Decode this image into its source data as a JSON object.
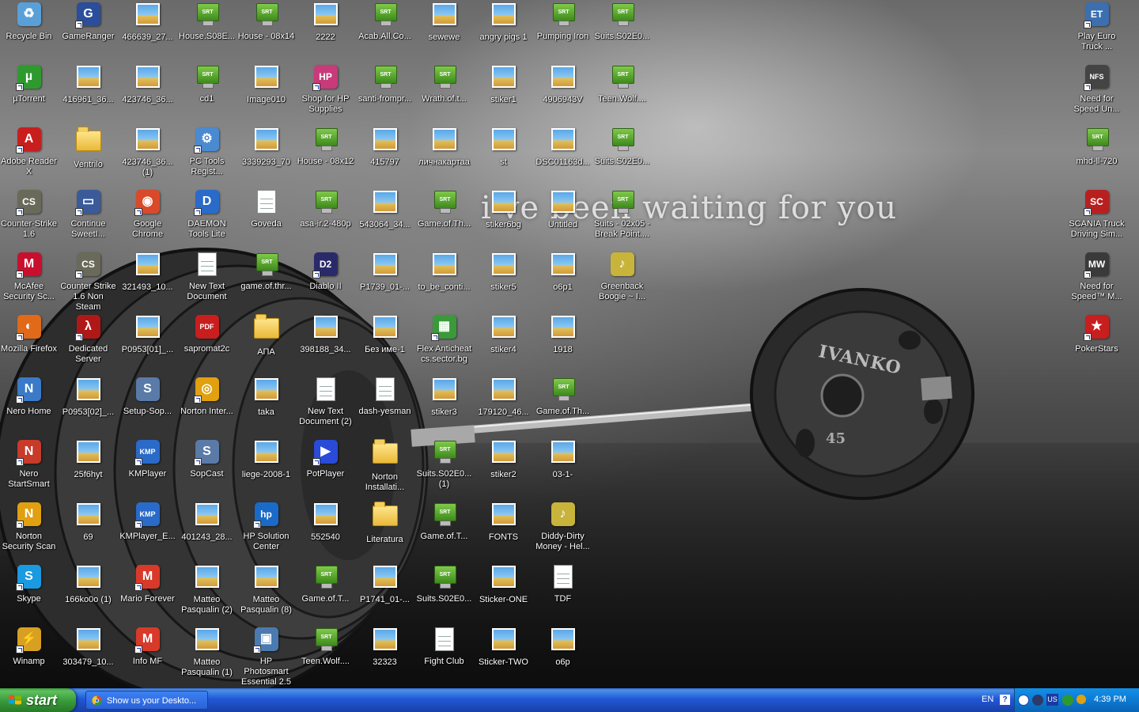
{
  "wallpaper": {
    "tagline": "i've been waiting for you",
    "plate_brand": "IVANKO",
    "plate_weight": "45"
  },
  "icons": [
    {
      "label": "Recycle Bin",
      "col": 0,
      "row": 0,
      "kind": "app",
      "color": "#5aa0d8",
      "glyph": "♻",
      "shortcut": false
    },
    {
      "label": "GameRanger",
      "col": 1,
      "row": 0,
      "kind": "app",
      "color": "#2a4d9c",
      "glyph": "G",
      "shortcut": true
    },
    {
      "label": "466639_27...",
      "col": 2,
      "row": 0,
      "kind": "image"
    },
    {
      "label": "House.S08E...",
      "col": 3,
      "row": 0,
      "kind": "srt"
    },
    {
      "label": "House - 08x14",
      "col": 4,
      "row": 0,
      "kind": "srt"
    },
    {
      "label": "2222",
      "col": 5,
      "row": 0,
      "kind": "image"
    },
    {
      "label": "Acab.All.Co...",
      "col": 6,
      "row": 0,
      "kind": "srt"
    },
    {
      "label": "sewewe",
      "col": 7,
      "row": 0,
      "kind": "image"
    },
    {
      "label": "angry pigs 1",
      "col": 8,
      "row": 0,
      "kind": "image"
    },
    {
      "label": "Pumping Iron",
      "col": 9,
      "row": 0,
      "kind": "srt"
    },
    {
      "label": "Suits.S02E0...",
      "col": 10,
      "row": 0,
      "kind": "srt"
    },
    {
      "label": "Play Euro Truck ...",
      "col": 18,
      "row": 0,
      "kind": "app",
      "color": "#3b6fb0",
      "glyph": "ET",
      "shortcut": true
    },
    {
      "label": "µTorrent",
      "col": 0,
      "row": 1,
      "kind": "app",
      "color": "#2e9a2e",
      "glyph": "µ",
      "shortcut": true
    },
    {
      "label": "416961_36...",
      "col": 1,
      "row": 1,
      "kind": "image"
    },
    {
      "label": "423746_36...",
      "col": 2,
      "row": 1,
      "kind": "image"
    },
    {
      "label": "cd1",
      "col": 3,
      "row": 1,
      "kind": "srt"
    },
    {
      "label": "Image010",
      "col": 4,
      "row": 1,
      "kind": "image"
    },
    {
      "label": "Shop for HP Supplies",
      "col": 5,
      "row": 1,
      "kind": "app",
      "color": "#c83a7a",
      "glyph": "HP",
      "shortcut": true
    },
    {
      "label": "santi-frompr...",
      "col": 6,
      "row": 1,
      "kind": "srt"
    },
    {
      "label": "Wrath.of.t...",
      "col": 7,
      "row": 1,
      "kind": "srt"
    },
    {
      "label": "stiker1",
      "col": 8,
      "row": 1,
      "kind": "image"
    },
    {
      "label": "4906943V",
      "col": 9,
      "row": 1,
      "kind": "image"
    },
    {
      "label": "Teen.Wolf....",
      "col": 10,
      "row": 1,
      "kind": "srt"
    },
    {
      "label": "Need for Speed Un...",
      "col": 18,
      "row": 1,
      "kind": "app",
      "color": "#444",
      "glyph": "NFS",
      "shortcut": true
    },
    {
      "label": "Adobe Reader X",
      "col": 0,
      "row": 2,
      "kind": "app",
      "color": "#c81e1e",
      "glyph": "A",
      "shortcut": true
    },
    {
      "label": "Ventrilo",
      "col": 1,
      "row": 2,
      "kind": "folder"
    },
    {
      "label": "423746_36... (1)",
      "col": 2,
      "row": 2,
      "kind": "image"
    },
    {
      "label": "PC Tools Regist...",
      "col": 3,
      "row": 2,
      "kind": "app",
      "color": "#4a8ad0",
      "glyph": "⚙",
      "shortcut": true
    },
    {
      "label": "3339293_70",
      "col": 4,
      "row": 2,
      "kind": "image"
    },
    {
      "label": "House - 08x12",
      "col": 5,
      "row": 2,
      "kind": "srt"
    },
    {
      "label": "415797",
      "col": 6,
      "row": 2,
      "kind": "image"
    },
    {
      "label": "личнакартаа",
      "col": 7,
      "row": 2,
      "kind": "image"
    },
    {
      "label": "st",
      "col": 8,
      "row": 2,
      "kind": "image"
    },
    {
      "label": "DSC01163d...",
      "col": 9,
      "row": 2,
      "kind": "image"
    },
    {
      "label": "Suits.S02E0...",
      "col": 10,
      "row": 2,
      "kind": "srt"
    },
    {
      "label": "mhd-ll-720",
      "col": 18,
      "row": 2,
      "kind": "srt"
    },
    {
      "label": "Counter-Strike 1.6",
      "col": 0,
      "row": 3,
      "kind": "app",
      "color": "#6a6a5a",
      "glyph": "CS",
      "shortcut": true
    },
    {
      "label": "Continue SweetI...",
      "col": 1,
      "row": 3,
      "kind": "app",
      "color": "#3a5a9a",
      "glyph": "▭",
      "shortcut": true
    },
    {
      "label": "Google Chrome",
      "col": 2,
      "row": 3,
      "kind": "app",
      "color": "#d84a2a",
      "glyph": "◉",
      "shortcut": true
    },
    {
      "label": "DAEMON Tools Lite",
      "col": 3,
      "row": 3,
      "kind": "app",
      "color": "#2a6ac8",
      "glyph": "D",
      "shortcut": true
    },
    {
      "label": "Goveda",
      "col": 4,
      "row": 3,
      "kind": "doc"
    },
    {
      "label": "asa-ir.2-480p",
      "col": 5,
      "row": 3,
      "kind": "srt"
    },
    {
      "label": "543064_34...",
      "col": 6,
      "row": 3,
      "kind": "image"
    },
    {
      "label": "Game.of.Th...",
      "col": 7,
      "row": 3,
      "kind": "srt"
    },
    {
      "label": "stiker6bg",
      "col": 8,
      "row": 3,
      "kind": "image"
    },
    {
      "label": "Untitled",
      "col": 9,
      "row": 3,
      "kind": "image"
    },
    {
      "label": "Suits - 02x05 - Break Point....",
      "col": 10,
      "row": 3,
      "kind": "srt"
    },
    {
      "label": "SCANIA Truck Driving Sim...",
      "col": 18,
      "row": 3,
      "kind": "app",
      "color": "#b82020",
      "glyph": "SC",
      "shortcut": true
    },
    {
      "label": "McAfee Security Sc...",
      "col": 0,
      "row": 4,
      "kind": "app",
      "color": "#c8102e",
      "glyph": "M",
      "shortcut": true
    },
    {
      "label": "Counter Strike 1.6 Non Steam",
      "col": 1,
      "row": 4,
      "kind": "app",
      "color": "#6a6a5a",
      "glyph": "CS",
      "shortcut": true
    },
    {
      "label": "321493_10...",
      "col": 2,
      "row": 4,
      "kind": "image"
    },
    {
      "label": "New Text Document",
      "col": 3,
      "row": 4,
      "kind": "doc"
    },
    {
      "label": "game.of.thr...",
      "col": 4,
      "row": 4,
      "kind": "srt"
    },
    {
      "label": "Diablo II",
      "col": 5,
      "row": 4,
      "kind": "app",
      "color": "#2a2a6a",
      "glyph": "D2",
      "shortcut": true
    },
    {
      "label": "P1739_01-...",
      "col": 6,
      "row": 4,
      "kind": "image"
    },
    {
      "label": "to_be_conti...",
      "col": 7,
      "row": 4,
      "kind": "image"
    },
    {
      "label": "stiker5",
      "col": 8,
      "row": 4,
      "kind": "image"
    },
    {
      "label": "o6p1",
      "col": 9,
      "row": 4,
      "kind": "image"
    },
    {
      "label": "Greenback Boogie ~ I...",
      "col": 10,
      "row": 4,
      "kind": "app",
      "color": "#c8b43a",
      "glyph": "♪",
      "shortcut": false
    },
    {
      "label": "Need for Speed™ M...",
      "col": 18,
      "row": 4,
      "kind": "app",
      "color": "#3a3a3a",
      "glyph": "MW",
      "shortcut": true
    },
    {
      "label": "Mozilla Firefox",
      "col": 0,
      "row": 5,
      "kind": "app",
      "color": "#e06a1a",
      "glyph": "◐",
      "shortcut": true
    },
    {
      "label": "Dedicated Server",
      "col": 1,
      "row": 5,
      "kind": "app",
      "color": "#b01818",
      "glyph": "λ",
      "shortcut": true
    },
    {
      "label": "P0953[01]_...",
      "col": 2,
      "row": 5,
      "kind": "image"
    },
    {
      "label": "sapromat2c",
      "col": 3,
      "row": 5,
      "kind": "app",
      "color": "#c81e1e",
      "glyph": "PDF",
      "shortcut": false
    },
    {
      "label": "АПА",
      "col": 4,
      "row": 5,
      "kind": "folder"
    },
    {
      "label": "398188_34...",
      "col": 5,
      "row": 5,
      "kind": "image"
    },
    {
      "label": "Без име-1",
      "col": 6,
      "row": 5,
      "kind": "image"
    },
    {
      "label": "Flex Anticheat cs.sector.bg",
      "col": 7,
      "row": 5,
      "kind": "app",
      "color": "#3a9a3a",
      "glyph": "▦",
      "shortcut": true
    },
    {
      "label": "stiker4",
      "col": 8,
      "row": 5,
      "kind": "image"
    },
    {
      "label": "1918",
      "col": 9,
      "row": 5,
      "kind": "image"
    },
    {
      "label": "PokerStars",
      "col": 18,
      "row": 5,
      "kind": "app",
      "color": "#c81e1e",
      "glyph": "★",
      "shortcut": true
    },
    {
      "label": "Nero Home",
      "col": 0,
      "row": 6,
      "kind": "app",
      "color": "#3a7ac8",
      "glyph": "N",
      "shortcut": true
    },
    {
      "label": "P0953[02]_...",
      "col": 1,
      "row": 6,
      "kind": "image"
    },
    {
      "label": "Setup-Sop...",
      "col": 2,
      "row": 6,
      "kind": "app",
      "color": "#5a7aa8",
      "glyph": "S",
      "shortcut": false
    },
    {
      "label": "Norton Inter...",
      "col": 3,
      "row": 6,
      "kind": "app",
      "color": "#e0a010",
      "glyph": "◎",
      "shortcut": true
    },
    {
      "label": "taka",
      "col": 4,
      "row": 6,
      "kind": "image"
    },
    {
      "label": "New Text Document (2)",
      "col": 5,
      "row": 6,
      "kind": "doc"
    },
    {
      "label": "dash-yesman",
      "col": 6,
      "row": 6,
      "kind": "doc"
    },
    {
      "label": "stiker3",
      "col": 7,
      "row": 6,
      "kind": "image"
    },
    {
      "label": "179120_46...",
      "col": 8,
      "row": 6,
      "kind": "image"
    },
    {
      "label": "Game.of.Th...",
      "col": 9,
      "row": 6,
      "kind": "srt"
    },
    {
      "label": "Nero StartSmart",
      "col": 0,
      "row": 7,
      "kind": "app",
      "color": "#c83a2a",
      "glyph": "N",
      "shortcut": true
    },
    {
      "label": "25f6hyt",
      "col": 1,
      "row": 7,
      "kind": "image"
    },
    {
      "label": "KMPlayer",
      "col": 2,
      "row": 7,
      "kind": "app",
      "color": "#2a6ac8",
      "glyph": "KMP",
      "shortcut": true
    },
    {
      "label": "SopCast",
      "col": 3,
      "row": 7,
      "kind": "app",
      "color": "#5a7aa8",
      "glyph": "S",
      "shortcut": true
    },
    {
      "label": "liege-2008-1",
      "col": 4,
      "row": 7,
      "kind": "image"
    },
    {
      "label": "PotPlayer",
      "col": 5,
      "row": 7,
      "kind": "app",
      "color": "#2a4ad8",
      "glyph": "▶",
      "shortcut": true
    },
    {
      "label": "Norton Installati...",
      "col": 6,
      "row": 7,
      "kind": "folder"
    },
    {
      "label": "Suits.S02E0... (1)",
      "col": 7,
      "row": 7,
      "kind": "srt"
    },
    {
      "label": "stiker2",
      "col": 8,
      "row": 7,
      "kind": "image"
    },
    {
      "label": "03-1-",
      "col": 9,
      "row": 7,
      "kind": "image"
    },
    {
      "label": "Norton Security Scan",
      "col": 0,
      "row": 8,
      "kind": "app",
      "color": "#e0a010",
      "glyph": "N",
      "shortcut": true
    },
    {
      "label": "69",
      "col": 1,
      "row": 8,
      "kind": "image"
    },
    {
      "label": "KMPlayer_E...",
      "col": 2,
      "row": 8,
      "kind": "app",
      "color": "#2a6ac8",
      "glyph": "KMP",
      "shortcut": true
    },
    {
      "label": "401243_28...",
      "col": 3,
      "row": 8,
      "kind": "image"
    },
    {
      "label": "HP Solution Center",
      "col": 4,
      "row": 8,
      "kind": "app",
      "color": "#1a6ac8",
      "glyph": "hp",
      "shortcut": true
    },
    {
      "label": "552540",
      "col": 5,
      "row": 8,
      "kind": "image"
    },
    {
      "label": "Literatura",
      "col": 6,
      "row": 8,
      "kind": "folder"
    },
    {
      "label": "Game.of.T...",
      "col": 7,
      "row": 8,
      "kind": "srt"
    },
    {
      "label": "FONTS",
      "col": 8,
      "row": 8,
      "kind": "image"
    },
    {
      "label": "Diddy-Dirty Money - Hel...",
      "col": 9,
      "row": 8,
      "kind": "app",
      "color": "#c8b43a",
      "glyph": "♪",
      "shortcut": false
    },
    {
      "label": "Skype",
      "col": 0,
      "row": 9,
      "kind": "app",
      "color": "#1a9ae0",
      "glyph": "S",
      "shortcut": true
    },
    {
      "label": "166ko0o (1)",
      "col": 1,
      "row": 9,
      "kind": "image"
    },
    {
      "label": "Mario Forever",
      "col": 2,
      "row": 9,
      "kind": "app",
      "color": "#d83a2a",
      "glyph": "M",
      "shortcut": true
    },
    {
      "label": "Matteo Pasqualin (2)",
      "col": 3,
      "row": 9,
      "kind": "image"
    },
    {
      "label": "Matteo Pasqualin (8)",
      "col": 4,
      "row": 9,
      "kind": "image"
    },
    {
      "label": "Game.of.T...",
      "col": 5,
      "row": 9,
      "kind": "srt"
    },
    {
      "label": "P1741_01-...",
      "col": 6,
      "row": 9,
      "kind": "image"
    },
    {
      "label": "Suits.S02E0...",
      "col": 7,
      "row": 9,
      "kind": "srt"
    },
    {
      "label": "Sticker-ONE",
      "col": 8,
      "row": 9,
      "kind": "image"
    },
    {
      "label": "TDF",
      "col": 9,
      "row": 9,
      "kind": "doc"
    },
    {
      "label": "Winamp",
      "col": 0,
      "row": 10,
      "kind": "app",
      "color": "#d8a020",
      "glyph": "⚡",
      "shortcut": true
    },
    {
      "label": "303479_10...",
      "col": 1,
      "row": 10,
      "kind": "image"
    },
    {
      "label": "Info MF",
      "col": 2,
      "row": 10,
      "kind": "app",
      "color": "#d83a2a",
      "glyph": "M",
      "shortcut": true
    },
    {
      "label": "Matteo Pasqualin (1)",
      "col": 3,
      "row": 10,
      "kind": "image"
    },
    {
      "label": "HP Photosmart Essential 2.5",
      "col": 4,
      "row": 10,
      "kind": "app",
      "color": "#4a7ab0",
      "glyph": "▣",
      "shortcut": true
    },
    {
      "label": "Teen.Wolf....",
      "col": 5,
      "row": 10,
      "kind": "srt"
    },
    {
      "label": "32323",
      "col": 6,
      "row": 10,
      "kind": "image"
    },
    {
      "label": "Fight Club",
      "col": 7,
      "row": 10,
      "kind": "doc"
    },
    {
      "label": "Sticker-TWO",
      "col": 8,
      "row": 10,
      "kind": "image"
    },
    {
      "label": "o6p",
      "col": 9,
      "row": 10,
      "kind": "image"
    }
  ],
  "taskbar": {
    "start_label": "start",
    "task_label": "Show us your Deskto...",
    "language": "EN",
    "help": "?",
    "tray_us": "US",
    "clock": "4:39 PM"
  }
}
